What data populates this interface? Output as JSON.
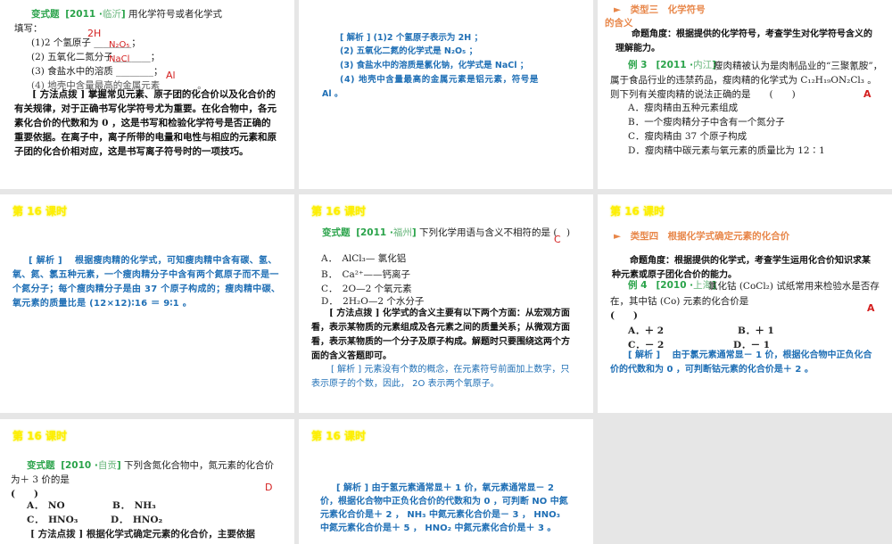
{
  "slides": [
    {
      "title_tag": "变式题",
      "source_year": "[2011 ·",
      "source_place": "临沂",
      "source_close": "]",
      "q": "用化学符号或者化学式",
      "q2": "填写：",
      "items": [
        "(1)2 个氢原子 ________；",
        "(2) 五氧化二氮分子________；",
        "(3) 食盐水中的溶质 ________；",
        "(4) 地壳中含量最高的金属元素________。"
      ],
      "answers": [
        "2H",
        "N₂O₅",
        "NaCl",
        "Al"
      ],
      "method": "[ 方法点拨 ] 掌握常见元素、原子团的化合价以及化合价的有关规律，对于正确书写化学符号尤为重要。在化合物中，各元素化合价的代数和为 0 ，这是书写和检验化学符号是否正确的重要依据。在离子中，离子所带的电量和电性与相应的元素和原子团的化合价相对应，这是书写离子符号时的一项技巧。"
    },
    {
      "lines": [
        "[ 解析 ] (1)2 个氢原子表示为 2H ；",
        "(2) 五氧化二氮的化学式是 N₂O₅ ；",
        "(3) 食盐水中的溶质是氯化钠，化学式是 NaCl ；",
        "(4) 地壳中含量最高的金属元素是铝元素，符号是",
        "Al 。"
      ]
    },
    {
      "type": "►　类型三　化学符号的含义",
      "angle": "命题角度：根据提供的化学符号，考查学生对化学符号含义的理解能力。",
      "ex": "例 3",
      "source_year": "[2011 ·",
      "source_place": "内江",
      "source_close": "]",
      "q": "瘦肉精被认为是肉制品业的“三聚氰胺”，属于食品行业的违禁药品，瘦肉精的化学式为 C₁₂H₁₉ON₂Cl₃ 。则下列有关瘦肉精的说法正确的是　　(　　)",
      "answer": "A",
      "options": [
        "A．瘦肉精由五种元素组成",
        "B．一个瘦肉精分子中含有一个氮分子",
        "C．瘦肉精由 37 个原子构成",
        "D．瘦肉精中碳元素与氧元素的质量比为 12∶1"
      ]
    },
    {
      "header": "第 16 课时",
      "analysis": "[ 解析 ]　 根据瘦肉精的化学式，可知瘦肉精中含有碳、氢、氧、氮、氯五种元素，一个瘦肉精分子中含有两个氮原子而不是一个氮分子；每个瘦肉精分子是由 37 个原子构成的；瘦肉精中碳、氧元素的质量比是 (12×12)∶16 ＝ 9∶1 。"
    },
    {
      "header": "第 16 课时",
      "title_tag": "变式题",
      "source_year": "[2011 ·",
      "source_place": "福州",
      "source_close": "]",
      "q": "下列化学用语与含义不相符的是 (　)",
      "answer": "C",
      "options": [
        "A．　AlCl₃— 氯化铝",
        "B．　Ca²⁺——钙离子",
        "C．　2O—2 个氧元素",
        "D．　2H₂O—2 个水分子"
      ],
      "method": "[ 方法点拨 ] 化学式的含义主要有以下两个方面：从宏观方面看，表示某物质的元素组成及各元素之间的质量关系；从微观方面看，表示某物质的一个分子及原子构成。解题时只要围绕这两个方面的含义答题即可。",
      "analysis": "[ 解析 ] 元素没有个数的概念，在元素符号前面加上数字，只表示原子的个数，因此， 2O 表示两个氧原子。"
    },
    {
      "header": "第 16 课时",
      "type": "►　类型四　根据化学式确定元素的化合价",
      "angle": "命题角度：根据提供的化学式，考查学生运用化合价知识求某种元素或原子团化合价的能力。",
      "ex": "例 4",
      "source_year": "[2010 ·",
      "source_place": "上海",
      "source_close": "]",
      "q": "氯化钴 (CoCl₂) 试纸常用来检验水是否存在，其中钴 (Co) 元素的化合价是",
      "paren": "(　　)",
      "answer": "A",
      "options": [
        "A．＋ 2",
        "B．＋ 1",
        "C．－ 2",
        "D．－ 1"
      ],
      "analysis": "[ 解析 ]　 由于氯元素通常显－ 1 价，根据化合物中正负化合价的代数和为 0 ，可判断钴元素的化合价是＋ 2 。"
    },
    {
      "header": "第 16 课时",
      "title_tag": "变式题",
      "source_year": "[2010 ·",
      "source_place": "自贡",
      "source_close": "]",
      "q": "下列含氮化合物中，氮元素的化合价为＋ 3 价的是",
      "paren": "(　　)",
      "answer": "D",
      "options": [
        "A．　NO",
        "B．　NH₃",
        "C．　HNO₃",
        "D．　HNO₂"
      ],
      "method": "[ 方法点拨 ] 根据化学式确定元素的化合价，主要依据"
    },
    {
      "header": "第 16 课时",
      "analysis": "[ 解析 ] 由于氢元素通常显＋ 1 价，氧元素通常显－ 2 价，根据化合物中正负化合价的代数和为 0 ，可判断 NO 中氮元素化合价是＋ 2 ， NH₃ 中氮元素化合价是－ 3 ， HNO₃ 中氮元素化合价是＋ 5 ， HNO₂ 中氮元素化合价是＋ 3 。"
    }
  ]
}
